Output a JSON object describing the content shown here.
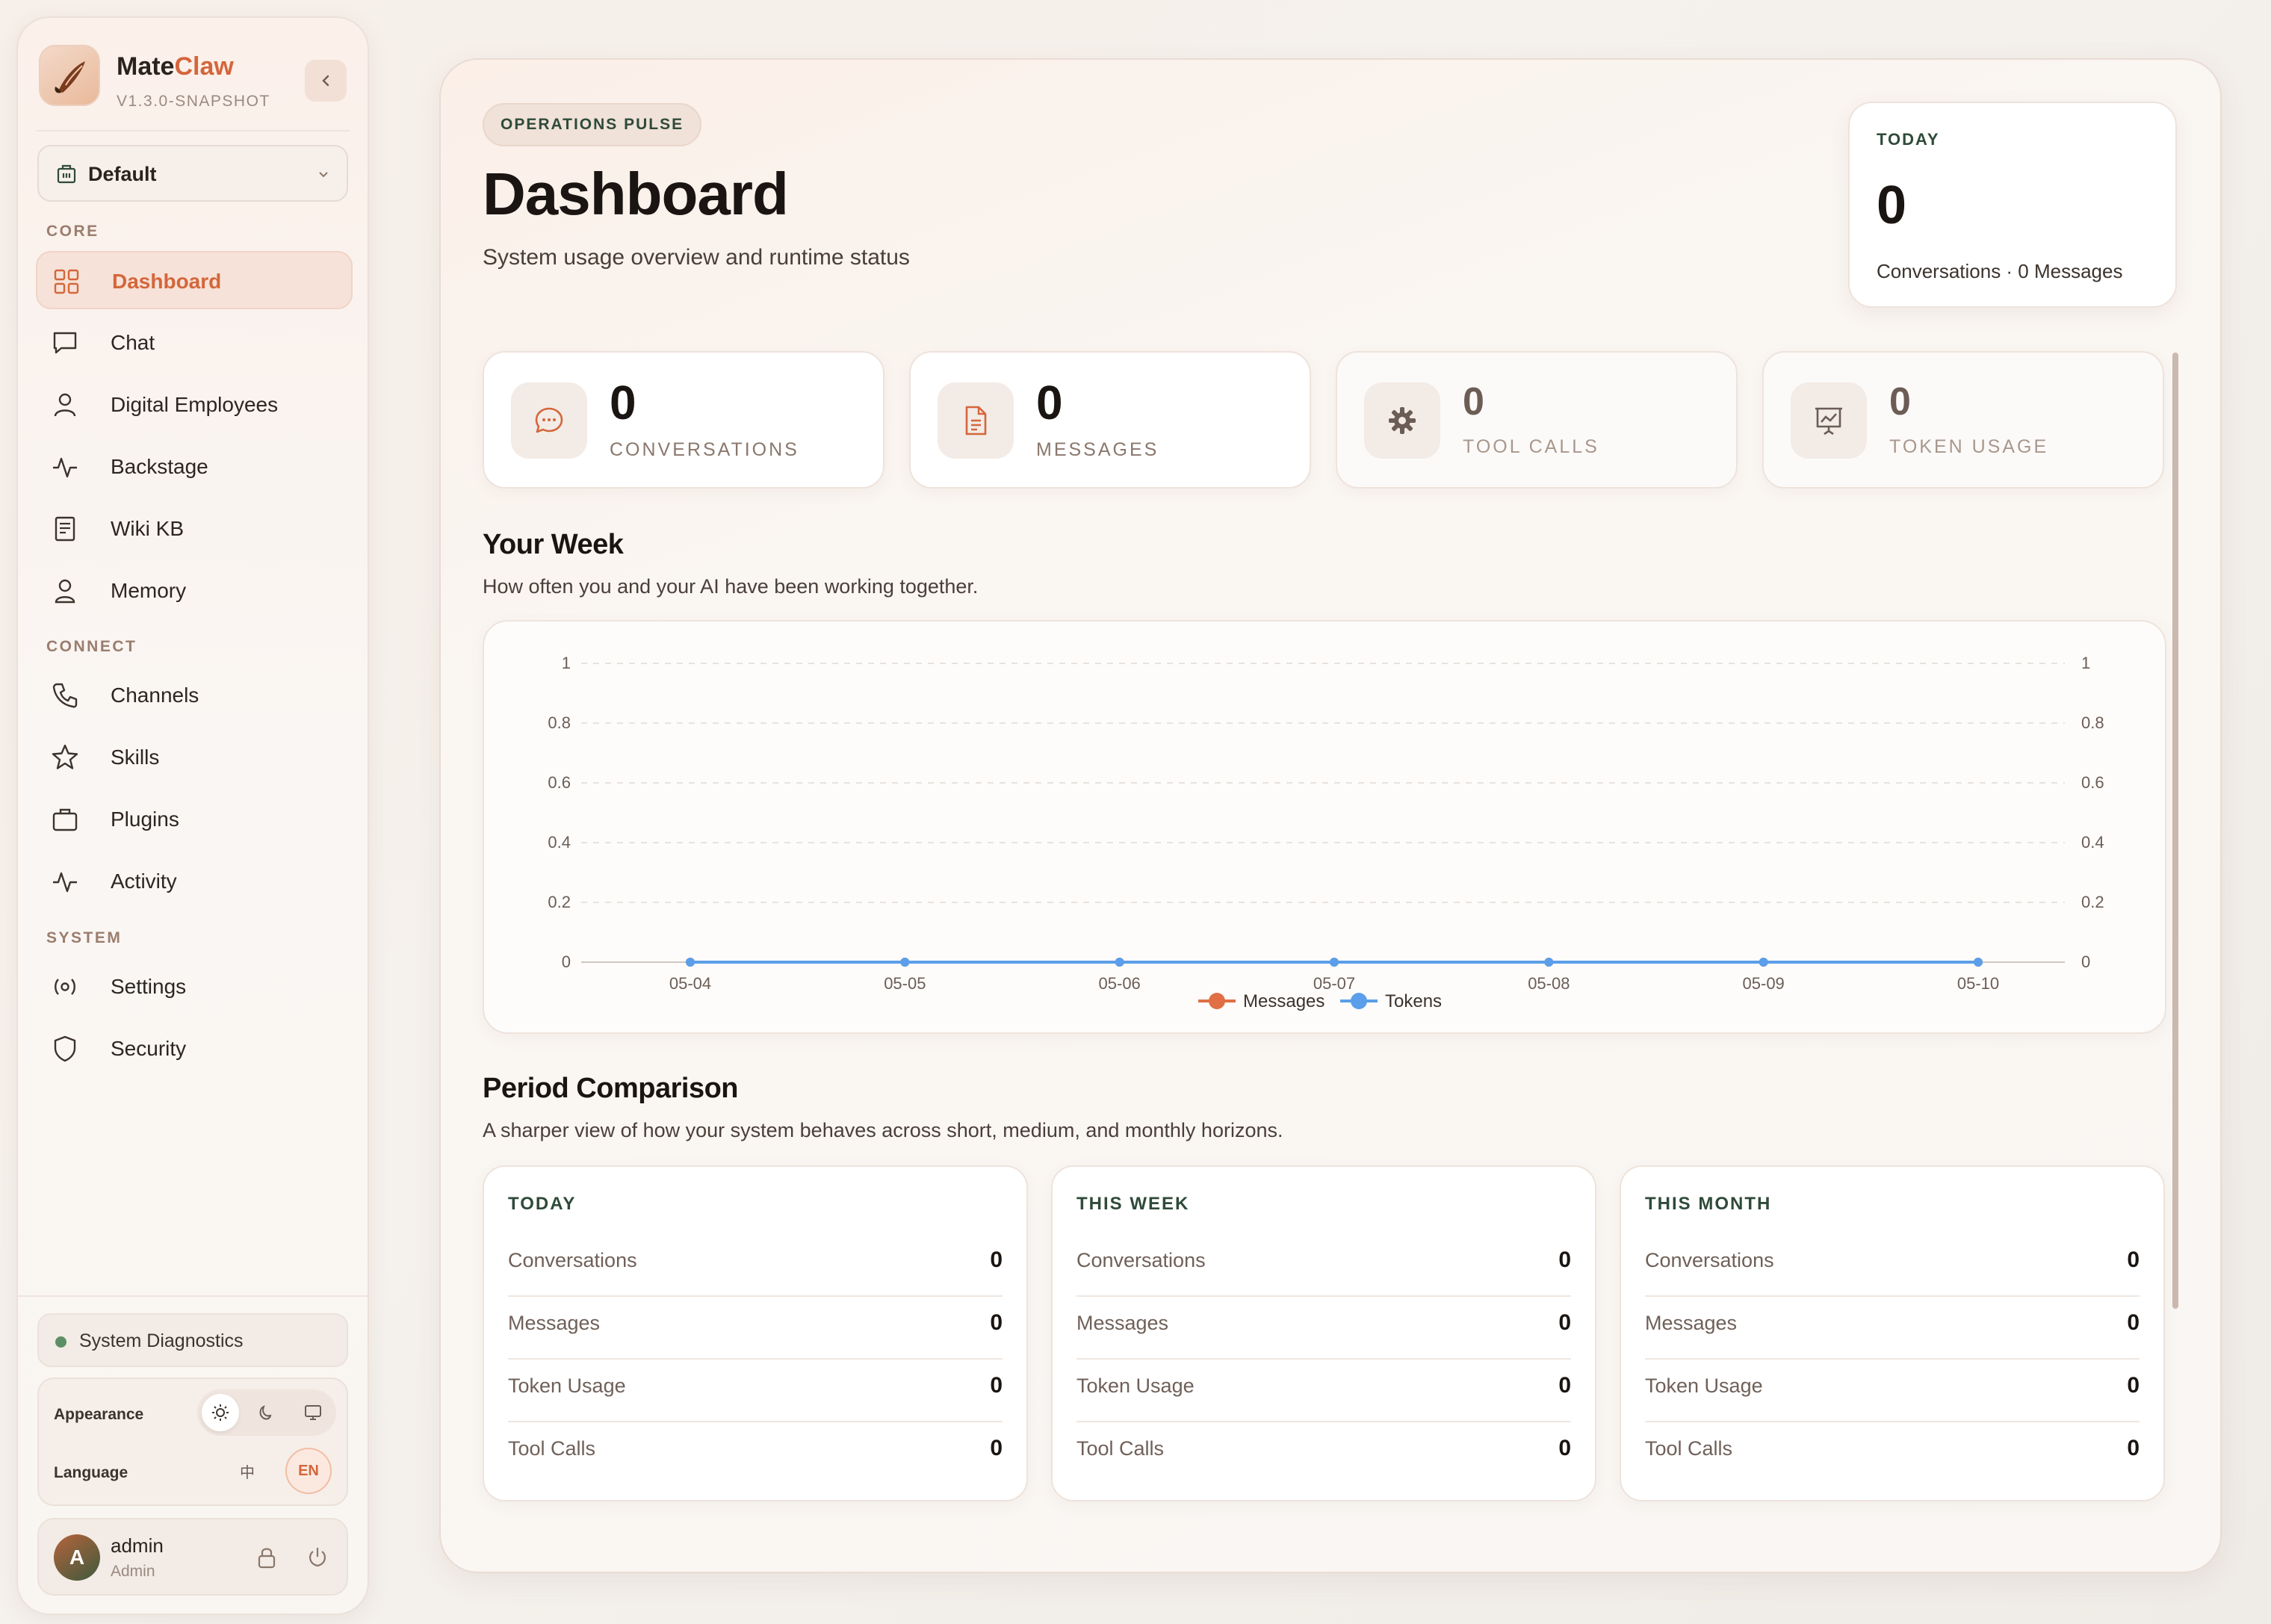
{
  "brand": {
    "name_main": "Mate",
    "name_accent": "Claw",
    "version": "V1.3.0-SNAPSHOT"
  },
  "workspace": {
    "selected": "Default"
  },
  "sidebar": {
    "sections": [
      {
        "label": "CORE",
        "items": [
          {
            "label": "Dashboard",
            "icon": "grid-icon",
            "active": true
          },
          {
            "label": "Chat",
            "icon": "chat-icon"
          },
          {
            "label": "Digital Employees",
            "icon": "user-icon"
          },
          {
            "label": "Backstage",
            "icon": "pulse-icon"
          },
          {
            "label": "Wiki KB",
            "icon": "book-icon"
          },
          {
            "label": "Memory",
            "icon": "memory-user-icon"
          }
        ]
      },
      {
        "label": "CONNECT",
        "items": [
          {
            "label": "Channels",
            "icon": "phone-icon"
          },
          {
            "label": "Skills",
            "icon": "star-icon"
          },
          {
            "label": "Plugins",
            "icon": "briefcase-icon"
          },
          {
            "label": "Activity",
            "icon": "activity-icon"
          }
        ]
      },
      {
        "label": "SYSTEM",
        "items": [
          {
            "label": "Settings",
            "icon": "settings-icon"
          },
          {
            "label": "Security",
            "icon": "shield-icon"
          }
        ]
      }
    ],
    "diagnostics_label": "System Diagnostics",
    "appearance_label": "Appearance",
    "language_label": "Language",
    "language_options": [
      "中",
      "EN"
    ],
    "user": {
      "initial": "A",
      "name": "admin",
      "role": "Admin"
    }
  },
  "main": {
    "tag": "OPERATIONS PULSE",
    "title": "Dashboard",
    "subtitle": "System usage overview and runtime status",
    "today_card": {
      "label": "TODAY",
      "value": "0",
      "sub": "Conversations · 0 Messages"
    },
    "stats": [
      {
        "value": "0",
        "label": "CONVERSATIONS",
        "icon": "chat-bubble-icon"
      },
      {
        "value": "0",
        "label": "MESSAGES",
        "icon": "document-icon"
      },
      {
        "value": "0",
        "label": "TOOL CALLS",
        "icon": "gear-icon"
      },
      {
        "value": "0",
        "label": "TOKEN USAGE",
        "icon": "presentation-chart-icon"
      }
    ],
    "week": {
      "title": "Your Week",
      "desc": "How often you and your AI have been working together."
    },
    "period": {
      "title": "Period Comparison",
      "desc": "A sharper view of how your system behaves across short, medium, and monthly horizons.",
      "cards": [
        {
          "title": "TODAY",
          "rows": [
            {
              "label": "Conversations",
              "value": "0"
            },
            {
              "label": "Messages",
              "value": "0"
            },
            {
              "label": "Token Usage",
              "value": "0"
            },
            {
              "label": "Tool Calls",
              "value": "0"
            }
          ]
        },
        {
          "title": "THIS WEEK",
          "rows": [
            {
              "label": "Conversations",
              "value": "0"
            },
            {
              "label": "Messages",
              "value": "0"
            },
            {
              "label": "Token Usage",
              "value": "0"
            },
            {
              "label": "Tool Calls",
              "value": "0"
            }
          ]
        },
        {
          "title": "THIS MONTH",
          "rows": [
            {
              "label": "Conversations",
              "value": "0"
            },
            {
              "label": "Messages",
              "value": "0"
            },
            {
              "label": "Token Usage",
              "value": "0"
            },
            {
              "label": "Tool Calls",
              "value": "0"
            }
          ]
        }
      ]
    }
  },
  "colors": {
    "accent": "#d4663b",
    "messages": "#e06f45",
    "tokens": "#5b9ee9",
    "green": "#2f4a3a"
  },
  "chart_data": {
    "type": "line",
    "x": [
      "05-04",
      "05-05",
      "05-06",
      "05-07",
      "05-08",
      "05-09",
      "05-10"
    ],
    "series": [
      {
        "name": "Messages",
        "values": [
          0,
          0,
          0,
          0,
          0,
          0,
          0
        ],
        "color": "#e06f45",
        "axis": "left"
      },
      {
        "name": "Tokens",
        "values": [
          0,
          0,
          0,
          0,
          0,
          0,
          0
        ],
        "color": "#5b9ee9",
        "axis": "right"
      }
    ],
    "yticks": [
      "0",
      "0.2",
      "0.4",
      "0.6",
      "0.8",
      "1"
    ],
    "ylim": [
      0,
      1
    ],
    "y2lim": [
      0,
      1
    ],
    "grid": true,
    "legend": "bottom-center"
  }
}
